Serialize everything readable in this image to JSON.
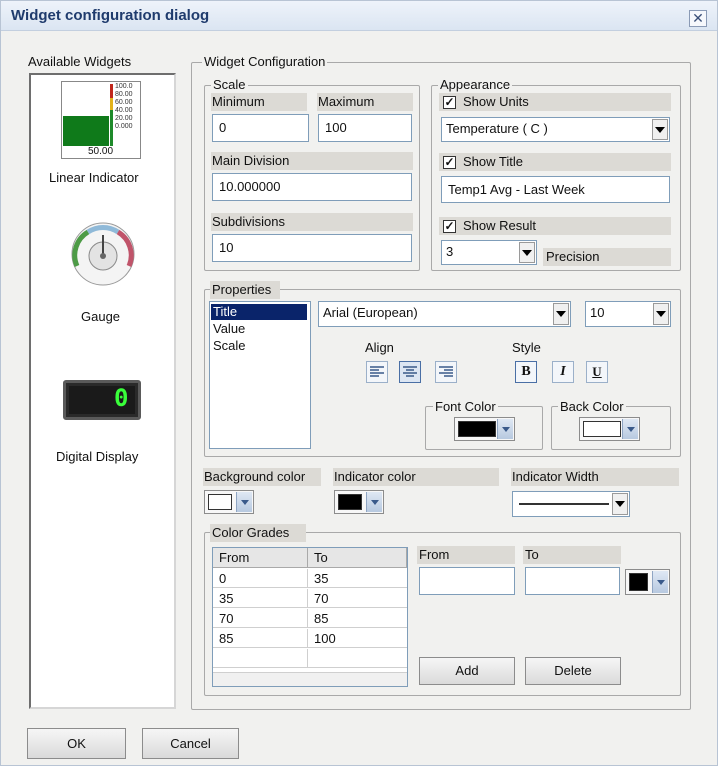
{
  "window": {
    "title": "Widget configuration dialog",
    "close_glyph": "✕"
  },
  "available_widgets": {
    "legend": "Available Widgets",
    "items": [
      {
        "label": "Linear Indicator",
        "icon": "linear-indicator-icon",
        "scale_labels": [
          "100.0",
          "80.00",
          "60.00",
          "40.00",
          "20.00",
          "0.000"
        ],
        "value_label": "50.00",
        "fill_percent": 50
      },
      {
        "label": "Gauge",
        "icon": "gauge-icon"
      },
      {
        "label": "Digital Display",
        "icon": "digital-display-icon",
        "digit": "0"
      }
    ]
  },
  "config": {
    "legend": "Widget Configuration",
    "scale": {
      "legend": "Scale",
      "minimum_label": "Minimum",
      "minimum_value": "0",
      "maximum_label": "Maximum",
      "maximum_value": "100",
      "main_division_label": "Main Division",
      "main_division_value": "10.000000",
      "subdivisions_label": "Subdivisions",
      "subdivisions_value": "10"
    },
    "appearance": {
      "legend": "Appearance",
      "show_units_label": "Show Units",
      "show_units_checked": true,
      "units_value": "Temperature ( C )",
      "show_title_label": "Show Title",
      "show_title_checked": true,
      "title_value": "Temp1 Avg - Last Week",
      "show_result_label": "Show Result",
      "show_result_checked": true,
      "precision_value": "3",
      "precision_label": "Precision"
    },
    "properties": {
      "legend": "Properties",
      "items": [
        "Title",
        "Value",
        "Scale"
      ],
      "selected_index": 0,
      "font_value": "Arial (European)",
      "size_value": "10",
      "align_label": "Align",
      "style_label": "Style",
      "style_bold": "B",
      "style_italic": "I",
      "style_underline": "U",
      "font_color_label": "Font Color",
      "font_color": "#000000",
      "back_color_label": "Back Color",
      "back_color": "#ffffff"
    },
    "background_color_label": "Background color",
    "background_color": "#ffffff",
    "indicator_color_label": "Indicator color",
    "indicator_color": "#000000",
    "indicator_width_label": "Indicator Width",
    "color_grades": {
      "legend": "Color Grades",
      "columns": [
        "From",
        "To"
      ],
      "rows": [
        [
          "0",
          "35"
        ],
        [
          "35",
          "70"
        ],
        [
          "70",
          "85"
        ],
        [
          "85",
          "100"
        ]
      ],
      "from_label": "From",
      "from_value": "",
      "to_label": "To",
      "to_value": "",
      "grade_color": "#000000",
      "add_label": "Add",
      "delete_label": "Delete"
    }
  },
  "footer": {
    "ok_label": "OK",
    "cancel_label": "Cancel"
  }
}
